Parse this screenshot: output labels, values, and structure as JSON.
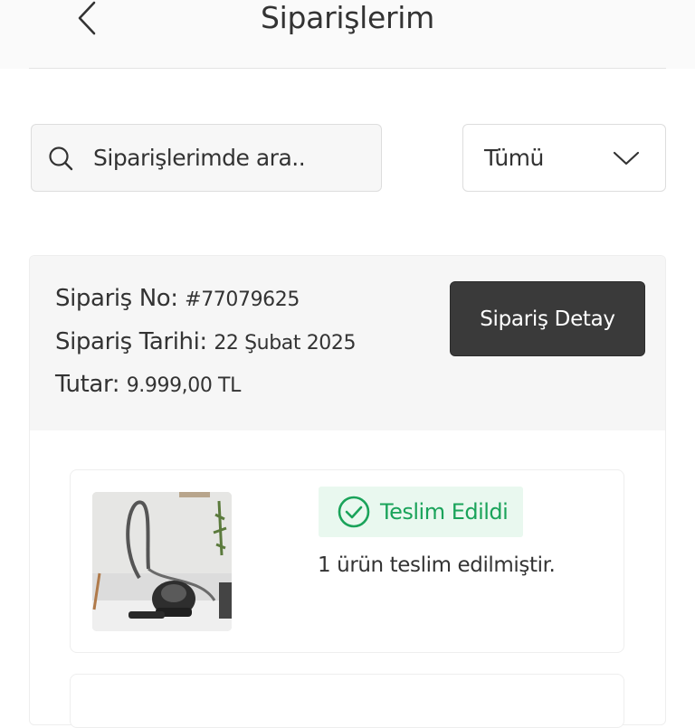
{
  "header": {
    "title": "Siparişlerim",
    "back_icon": "chevron-left-icon"
  },
  "search": {
    "placeholder": "Siparişlerimde ara..",
    "icon": "search-icon"
  },
  "filter": {
    "selected": "Tümü",
    "icon": "chevron-down-icon"
  },
  "order": {
    "number_label": "Sipariş No:",
    "number_value": "#77079625",
    "date_label": "Sipariş Tarihi:",
    "date_value": "22 Şubat 2025",
    "total_label": "Tutar:",
    "total_value": "9.999,00 TL",
    "detail_button": "Sipariş Detay",
    "item": {
      "status": "Teslim Edildi",
      "status_icon": "check-circle-icon",
      "note": "1 ürün teslim edilmiştir."
    }
  },
  "colors": {
    "accent_dark": "#3a3a3a",
    "status_green": "#1aa35a",
    "status_bg": "#e9f8ef"
  }
}
